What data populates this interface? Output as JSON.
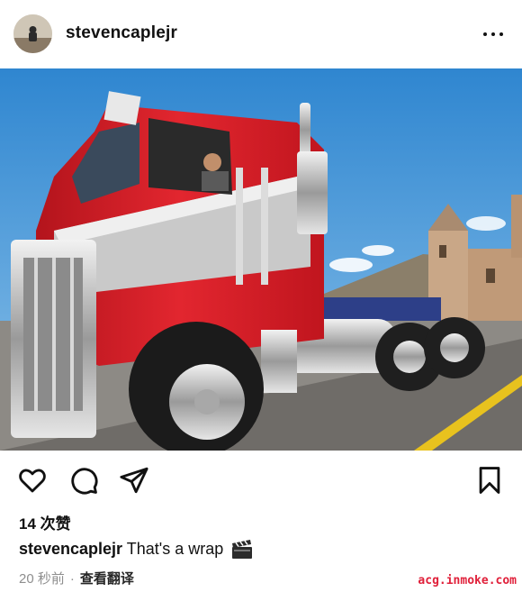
{
  "post": {
    "username": "stevencaplejr",
    "likes": "14 次赞",
    "caption_user": "stevencaplejr",
    "caption_text": "That's a wrap",
    "caption_emoji": "clapperboard-icon",
    "time_ago": "20 秒前",
    "separator": "·",
    "translate_label": "查看翻译"
  },
  "watermark": "acg.inmoke.com",
  "icons": [
    "more-icon",
    "heart-icon",
    "comment-icon",
    "share-icon",
    "bookmark-icon"
  ],
  "colors": {
    "truck_red": "#d8202c",
    "sky_blue": "#3f93d6",
    "text": "#111111",
    "meta": "#8e8e8e",
    "watermark": "#e0203a"
  }
}
